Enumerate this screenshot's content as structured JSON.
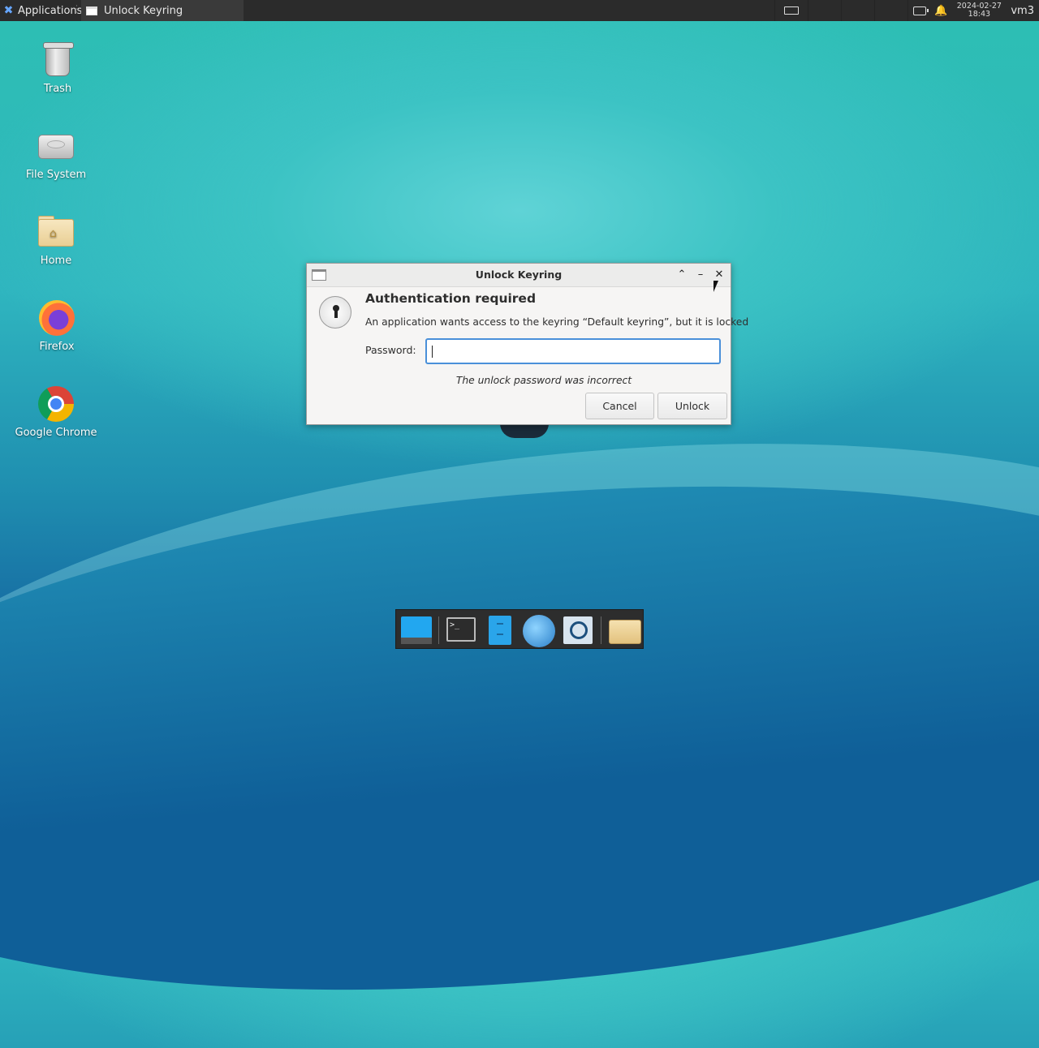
{
  "panel": {
    "applications_label": "Applications",
    "task_title": "Unlock Keyring",
    "clock_date": "2024-02-27",
    "clock_time": "18:43",
    "user": "vm3"
  },
  "desktop_icons": [
    {
      "label": "Trash",
      "icon": "trash-icon"
    },
    {
      "label": "File System",
      "icon": "drive-icon"
    },
    {
      "label": "Home",
      "icon": "home-folder-icon"
    },
    {
      "label": "Firefox",
      "icon": "firefox-icon"
    },
    {
      "label": "Google Chrome",
      "icon": "chrome-icon"
    }
  ],
  "dialog": {
    "window_title": "Unlock Keyring",
    "heading": "Authentication required",
    "message": "An application wants access to the keyring “Default keyring”, but it is locked",
    "password_label": "Password:",
    "password_value": "",
    "error": "The unlock password was incorrect",
    "cancel_label": "Cancel",
    "unlock_label": "Unlock",
    "accent_color": "#4a90d9"
  },
  "dock": [
    {
      "name": "show-desktop",
      "icon": "desktop-icon"
    },
    {
      "name": "terminal",
      "icon": "terminal-icon"
    },
    {
      "name": "file-manager",
      "icon": "files-icon"
    },
    {
      "name": "web-browser",
      "icon": "globe-icon"
    },
    {
      "name": "app-finder",
      "icon": "search-icon"
    },
    {
      "name": "home-folder",
      "icon": "folder-icon"
    }
  ]
}
